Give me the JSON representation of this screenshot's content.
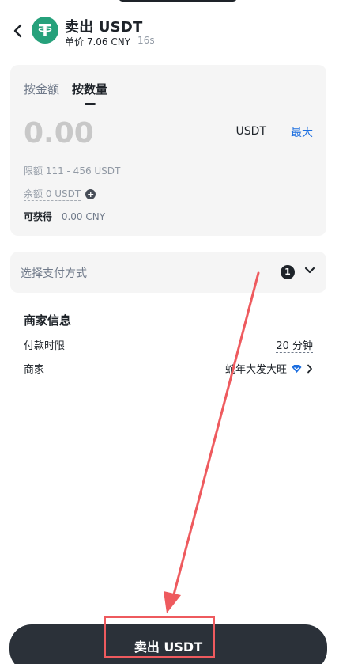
{
  "header": {
    "title": "卖出 USDT",
    "unit_price": "单价 7.06 CNY",
    "timer": "16s"
  },
  "tabs": [
    {
      "label": "按金额",
      "active": false
    },
    {
      "label": "按数量",
      "active": true
    }
  ],
  "amount": {
    "placeholder": "0.00",
    "unit": "USDT",
    "max_label": "最大",
    "limit": "限额 111 - 456 USDT",
    "balance": "余额 0 USDT",
    "receive_label": "可获得",
    "receive_value": "0.00 CNY"
  },
  "payment": {
    "label": "选择支付方式",
    "count": "1"
  },
  "merchant": {
    "title": "商家信息",
    "payment_time_label": "付款时限",
    "payment_time_value": "20 分钟",
    "merchant_label": "商家",
    "merchant_name": "蛇年大发大旺"
  },
  "sell_button": "卖出 USDT",
  "colors": {
    "usdt_green": "#26a17b",
    "link_blue": "#1d6fe0",
    "button_dark": "#2b3139",
    "annotation_red": "#ee5a5e"
  }
}
